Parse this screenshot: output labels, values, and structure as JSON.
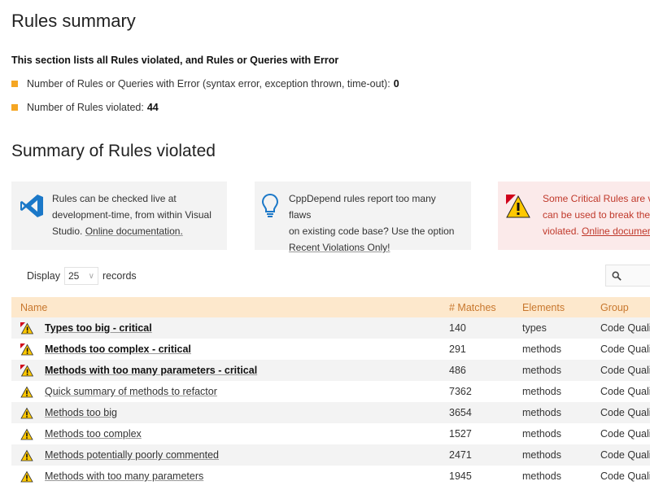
{
  "page": {
    "title": "Rules summary",
    "intro": "This section lists all Rules violated, and Rules or Queries with Error",
    "bullets": [
      {
        "label": "Number of Rules or Queries with Error (syntax error, exception thrown, time-out):",
        "value": "0"
      },
      {
        "label": "Number of Rules violated:",
        "value": "44"
      }
    ],
    "section_title": "Summary of Rules violated"
  },
  "cards": [
    {
      "icon": "visual-studio-icon",
      "lines": [
        "Rules can be checked live at",
        "development-time, from within Visual",
        "Studio."
      ],
      "link": "Online documentation."
    },
    {
      "icon": "lightbulb-icon",
      "lines": [
        "CppDepend rules report too many flaws",
        "on existing code base? Use the option"
      ],
      "link": "Recent Violations Only!"
    },
    {
      "icon": "critical-warning-icon",
      "lines": [
        "Some Critical Rules are v",
        "can be used to break the",
        "violated."
      ],
      "link": "Online documer"
    }
  ],
  "table_controls": {
    "display_label": "Display",
    "page_size": "25",
    "records_label": "records"
  },
  "table": {
    "headers": [
      "Name",
      "# Matches",
      "Elements",
      "Group"
    ],
    "rows": [
      {
        "name": "Types too big - critical",
        "matches": "140",
        "elements": "types",
        "group": "Code Quali",
        "critical": true
      },
      {
        "name": "Methods too complex - critical",
        "matches": "291",
        "elements": "methods",
        "group": "Code Quali",
        "critical": true
      },
      {
        "name": "Methods with too many parameters - critical",
        "matches": "486",
        "elements": "methods",
        "group": "Code Quali",
        "critical": true
      },
      {
        "name": "Quick summary of methods to refactor",
        "matches": "7362",
        "elements": "methods",
        "group": "Code Quali",
        "critical": false
      },
      {
        "name": "Methods too big",
        "matches": "3654",
        "elements": "methods",
        "group": "Code Quali",
        "critical": false
      },
      {
        "name": "Methods too complex",
        "matches": "1527",
        "elements": "methods",
        "group": "Code Quali",
        "critical": false
      },
      {
        "name": "Methods potentially poorly commented",
        "matches": "2471",
        "elements": "methods",
        "group": "Code Quali",
        "critical": false
      },
      {
        "name": "Methods with too many parameters",
        "matches": "1945",
        "elements": "methods",
        "group": "Code Quali",
        "critical": false
      }
    ]
  },
  "colors": {
    "accent": "#f5a623",
    "header_bg": "#fde8cc",
    "header_text": "#c8772d",
    "vs_blue": "#1b78c8",
    "critical_red": "#d0021b",
    "warning_yellow": "#ffc800"
  }
}
